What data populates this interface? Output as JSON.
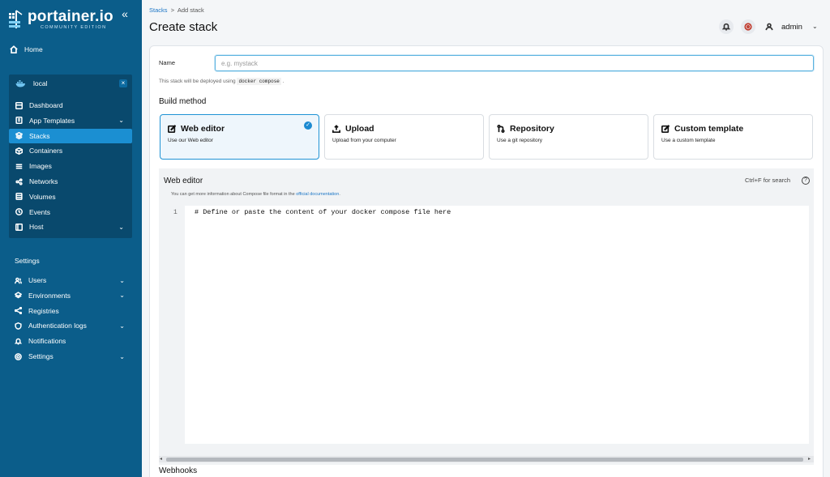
{
  "brand": {
    "name": "portainer.io",
    "edition": "COMMUNITY EDITION"
  },
  "sidebar": {
    "home": "Home",
    "environment": {
      "name": "local"
    },
    "env_items": [
      {
        "label": "Dashboard",
        "icon": "dashboard-icon"
      },
      {
        "label": "App Templates",
        "icon": "templates-icon",
        "chevron": true
      },
      {
        "label": "Stacks",
        "icon": "stacks-icon",
        "active": true
      },
      {
        "label": "Containers",
        "icon": "containers-icon"
      },
      {
        "label": "Images",
        "icon": "images-icon"
      },
      {
        "label": "Networks",
        "icon": "networks-icon"
      },
      {
        "label": "Volumes",
        "icon": "volumes-icon"
      },
      {
        "label": "Events",
        "icon": "events-icon"
      },
      {
        "label": "Host",
        "icon": "host-icon",
        "chevron": true
      }
    ],
    "settings_label": "Settings",
    "settings_items": [
      {
        "label": "Users",
        "icon": "users-icon",
        "chevron": true
      },
      {
        "label": "Environments",
        "icon": "environments-icon",
        "chevron": true
      },
      {
        "label": "Registries",
        "icon": "registries-icon"
      },
      {
        "label": "Authentication logs",
        "icon": "auth-logs-icon",
        "chevron": true
      },
      {
        "label": "Notifications",
        "icon": "notifications-icon"
      },
      {
        "label": "Settings",
        "icon": "settings-icon",
        "chevron": true
      }
    ]
  },
  "header": {
    "breadcrumb": {
      "root": "Stacks",
      "separator": ">",
      "current": "Add stack"
    },
    "title": "Create stack",
    "user": "admin"
  },
  "form": {
    "name_label": "Name",
    "name_placeholder": "e.g. mystack",
    "name_value": "",
    "helper_prefix": "This stack will be deployed using",
    "helper_code": "docker compose",
    "helper_suffix": ".",
    "build_method_title": "Build method",
    "methods": [
      {
        "title": "Web editor",
        "desc": "Use our Web editor",
        "icon": "edit-icon",
        "selected": true
      },
      {
        "title": "Upload",
        "desc": "Upload from your computer",
        "icon": "upload-icon",
        "selected": false
      },
      {
        "title": "Repository",
        "desc": "Use a git repository",
        "icon": "git-icon",
        "selected": false
      },
      {
        "title": "Custom template",
        "desc": "Use a custom template",
        "icon": "edit-icon",
        "selected": false
      }
    ]
  },
  "editor": {
    "title": "Web editor",
    "search_hint": "Ctrl+F for search",
    "info_prefix": "You can get more information about Compose file format in the",
    "info_link": "official documentation",
    "info_suffix": ".",
    "line_number": "1",
    "content": "# Define or paste the content of your docker compose file here"
  },
  "webhooks_title": "Webhooks",
  "colors": {
    "sidebar": "#0b5d8a",
    "env_box": "#09496d",
    "active": "#1b8fd2",
    "accent": "#1f93d4"
  }
}
